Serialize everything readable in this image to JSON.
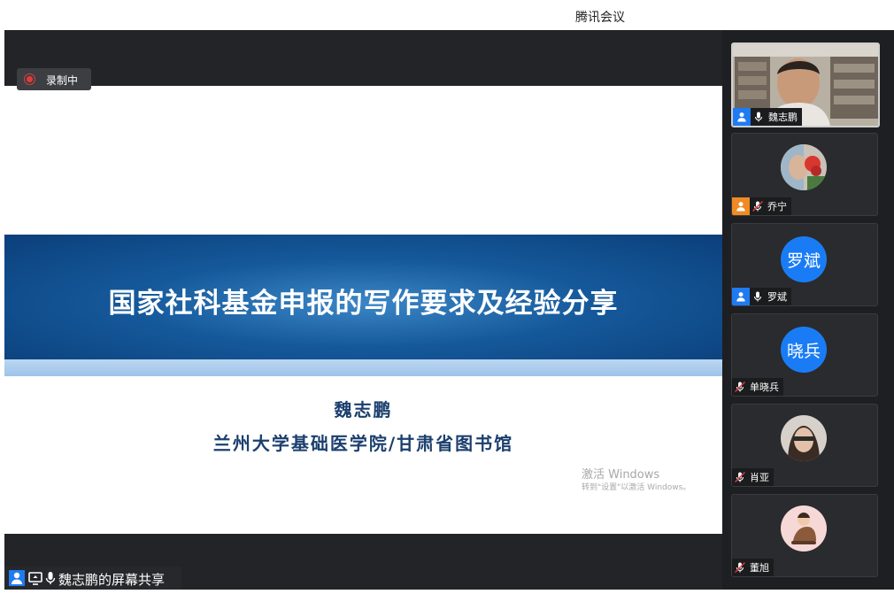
{
  "window": {
    "title": "腾讯会议"
  },
  "recording": {
    "label": "录制中"
  },
  "slide": {
    "title": "国家社科基金申报的写作要求及经验分享",
    "author": "魏志鹏",
    "affiliation": "兰州大学基础医学院/甘肃省图书馆",
    "watermark_line1": "激活 Windows",
    "watermark_line2": "转到\"设置\"以激活 Windows。"
  },
  "share_bar": {
    "label": "魏志鹏的屏幕共享"
  },
  "participants": [
    {
      "name": "魏志鹏",
      "video": "camera",
      "mic": "on"
    },
    {
      "name": "乔宁",
      "video": "photo",
      "mic": "muted"
    },
    {
      "name": "罗斌",
      "avatar_text": "罗斌",
      "mic": "on"
    },
    {
      "name": "单晓兵",
      "avatar_text": "晓兵",
      "mic": "muted"
    },
    {
      "name": "肖亚",
      "video": "photo",
      "mic": "muted"
    },
    {
      "name": "董旭",
      "video": "photo",
      "mic": "muted"
    }
  ],
  "colors": {
    "accent": "#1a7cf5",
    "banner": "#15599b",
    "muted": "#e23b3b"
  }
}
